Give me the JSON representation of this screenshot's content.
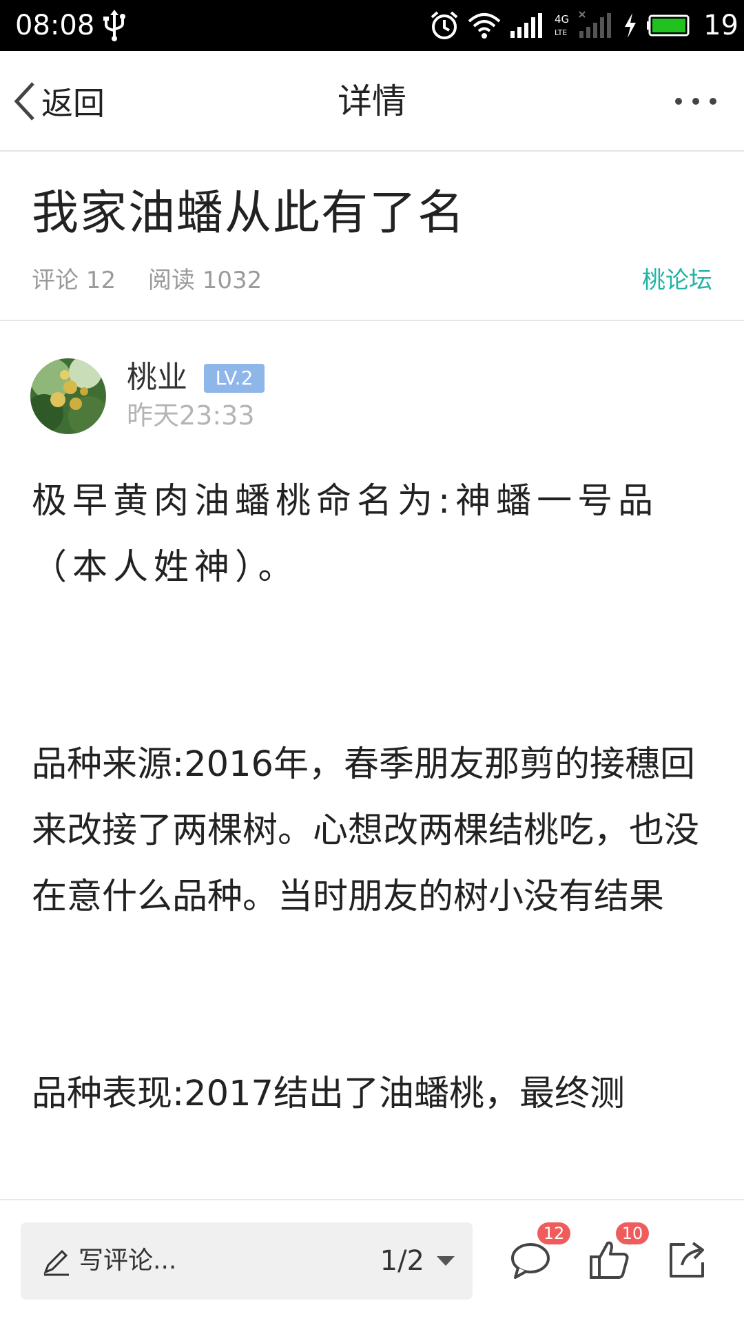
{
  "status_bar": {
    "time": "08:08",
    "battery_level": "19"
  },
  "nav": {
    "back_label": "返回",
    "title": "详情"
  },
  "article": {
    "title": "我家油蟠从此有了名",
    "comments_text": "评论 12",
    "reads_text": "阅读 1032",
    "forum": "桃论坛",
    "author": {
      "name": "桃业",
      "level": "LV.2",
      "time": "昨天23:33"
    },
    "paragraphs": [
      "极早黄肉油蟠桃命名为:神蟠一号品（本人姓神）。",
      "品种来源:2016年，春季朋友那剪的接穗回来改接了两棵树。心想改两棵结桃吃，也没在意什么品种。当时朋友的树小没有结果",
      "品种表现:2017结出了油蟠桃，最终测"
    ]
  },
  "bottom_bar": {
    "comment_placeholder": "写评论...",
    "page": "1/2",
    "comment_count": "12",
    "like_count": "10"
  },
  "colors": {
    "accent": "#1fb5a3",
    "badge_red": "#f05b5b",
    "level_badge": "#8eb6e8"
  },
  "icons": [
    "usb-icon",
    "alarm-icon",
    "wifi-icon",
    "signal-icon",
    "charging-icon",
    "battery-icon",
    "back-chevron-icon",
    "more-icon",
    "pencil-icon",
    "dropdown-caret-icon",
    "comment-icon",
    "thumbs-up-icon",
    "share-icon"
  ]
}
